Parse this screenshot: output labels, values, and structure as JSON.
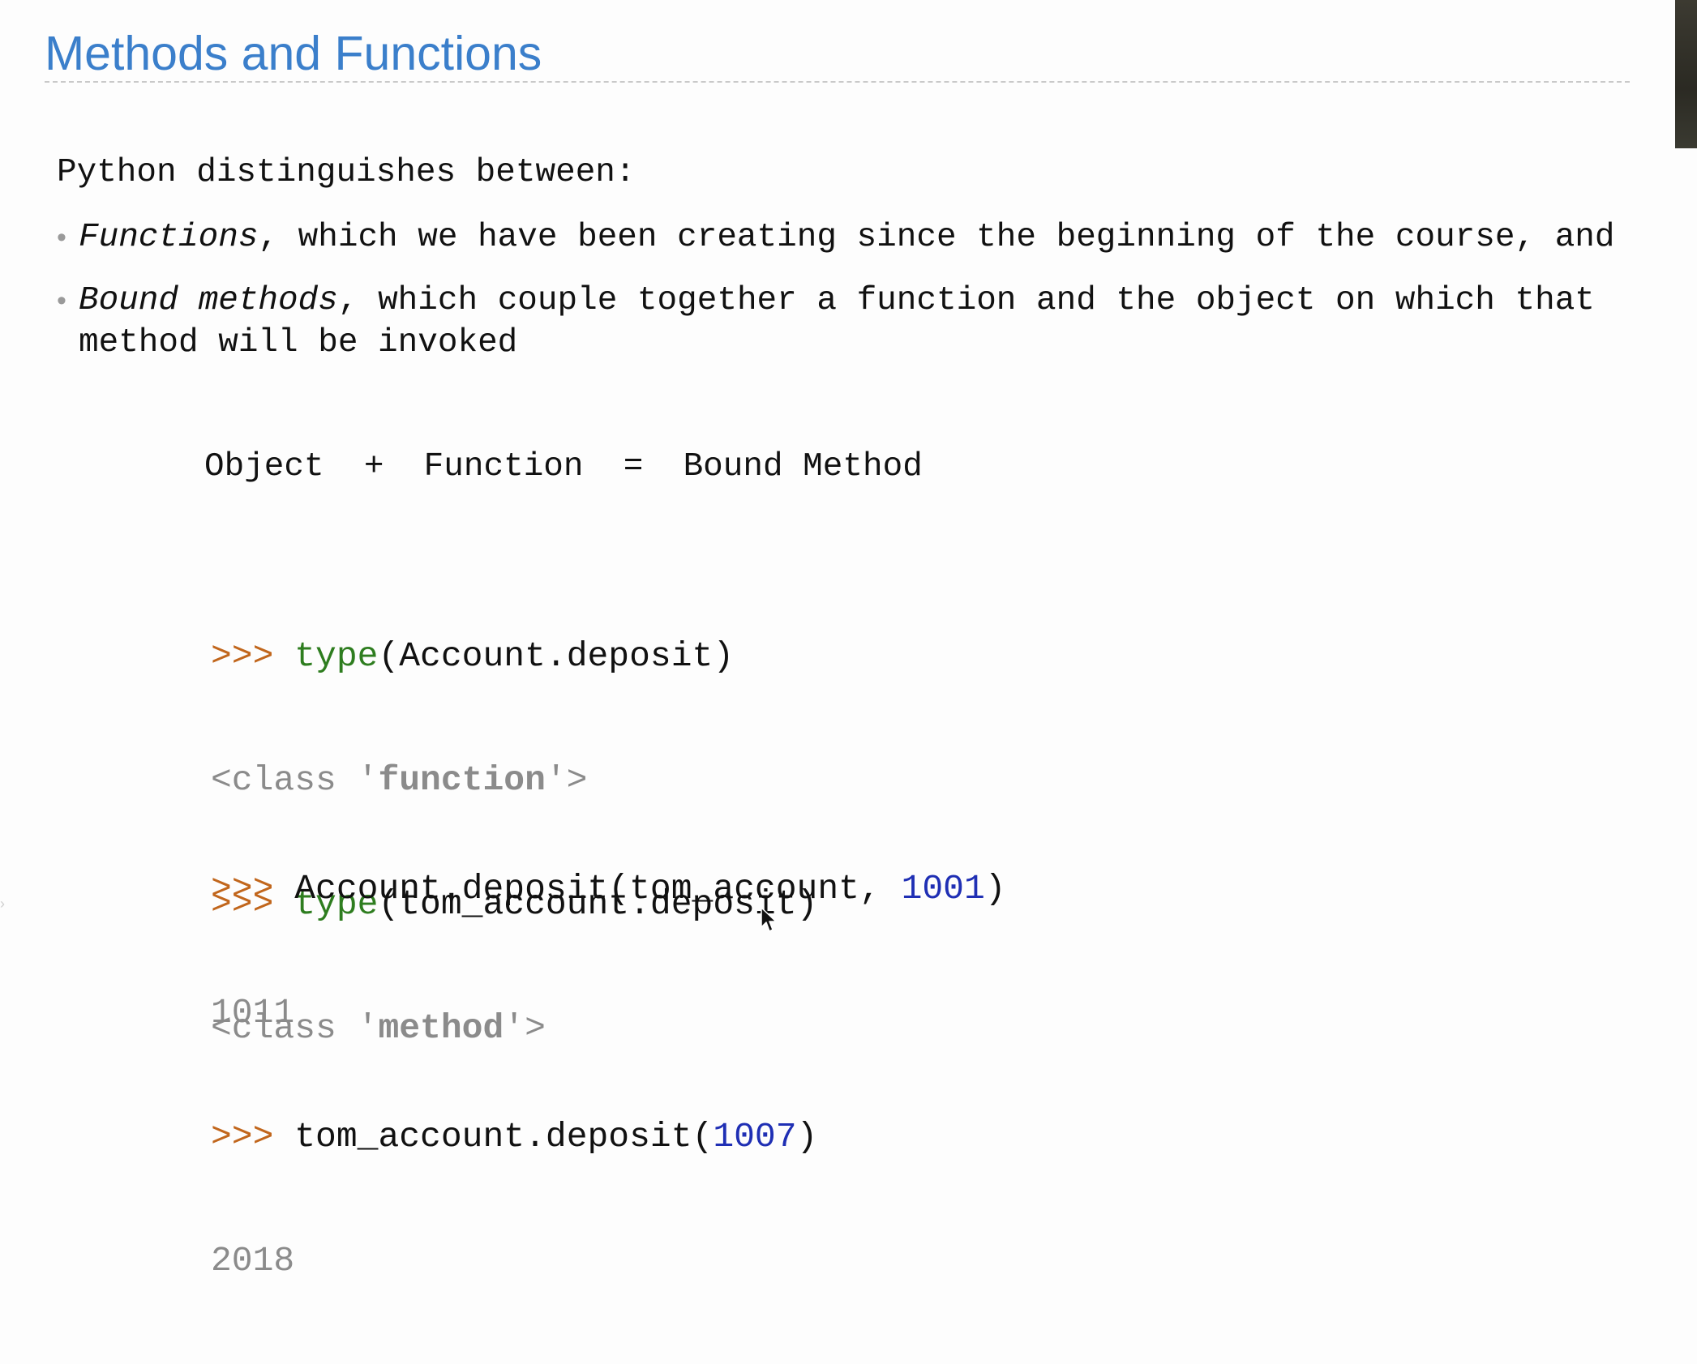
{
  "slide": {
    "title": "Methods and Functions",
    "intro": "Python distinguishes between:",
    "bullets": [
      {
        "emphasis": "Functions",
        "rest": ", which we have been creating since the beginning of the course, and"
      },
      {
        "emphasis": "Bound methods",
        "rest_line1": ", which couple together a function and the object on which that",
        "rest_line2": "method will be invoked"
      }
    ],
    "equation": {
      "object": "Object",
      "plus": "+",
      "function": "Function",
      "equals": "=",
      "result": "Bound Method"
    },
    "code_block_1": {
      "prompt": ">>>",
      "line1_fn": "type",
      "line1_args": "(Account.deposit)",
      "line2_prefix": "<class '",
      "line2_type": "function",
      "line2_suffix": "'>",
      "line3_fn": "type",
      "line3_args": "(tom_account.deposit)",
      "line4_prefix": "<class '",
      "line4_type": "method",
      "line4_suffix": "'>"
    },
    "code_block_2": {
      "prompt": ">>>",
      "line1_call": "Account.deposit(tom_account, ",
      "line1_num": "1001",
      "line1_close": ")",
      "line2_result": "1011",
      "line3_call": "tom_account.deposit(",
      "line3_num": "1007",
      "line3_close": ")",
      "line4_result": "2018"
    }
  },
  "colors": {
    "title": "#3b7fcb",
    "prompt": "#c1661c",
    "keyword": "#2e7d1f",
    "output": "#8b8b8b",
    "number": "#1f2fb4"
  },
  "icons": {
    "cursor": "mouse-pointer-icon"
  }
}
